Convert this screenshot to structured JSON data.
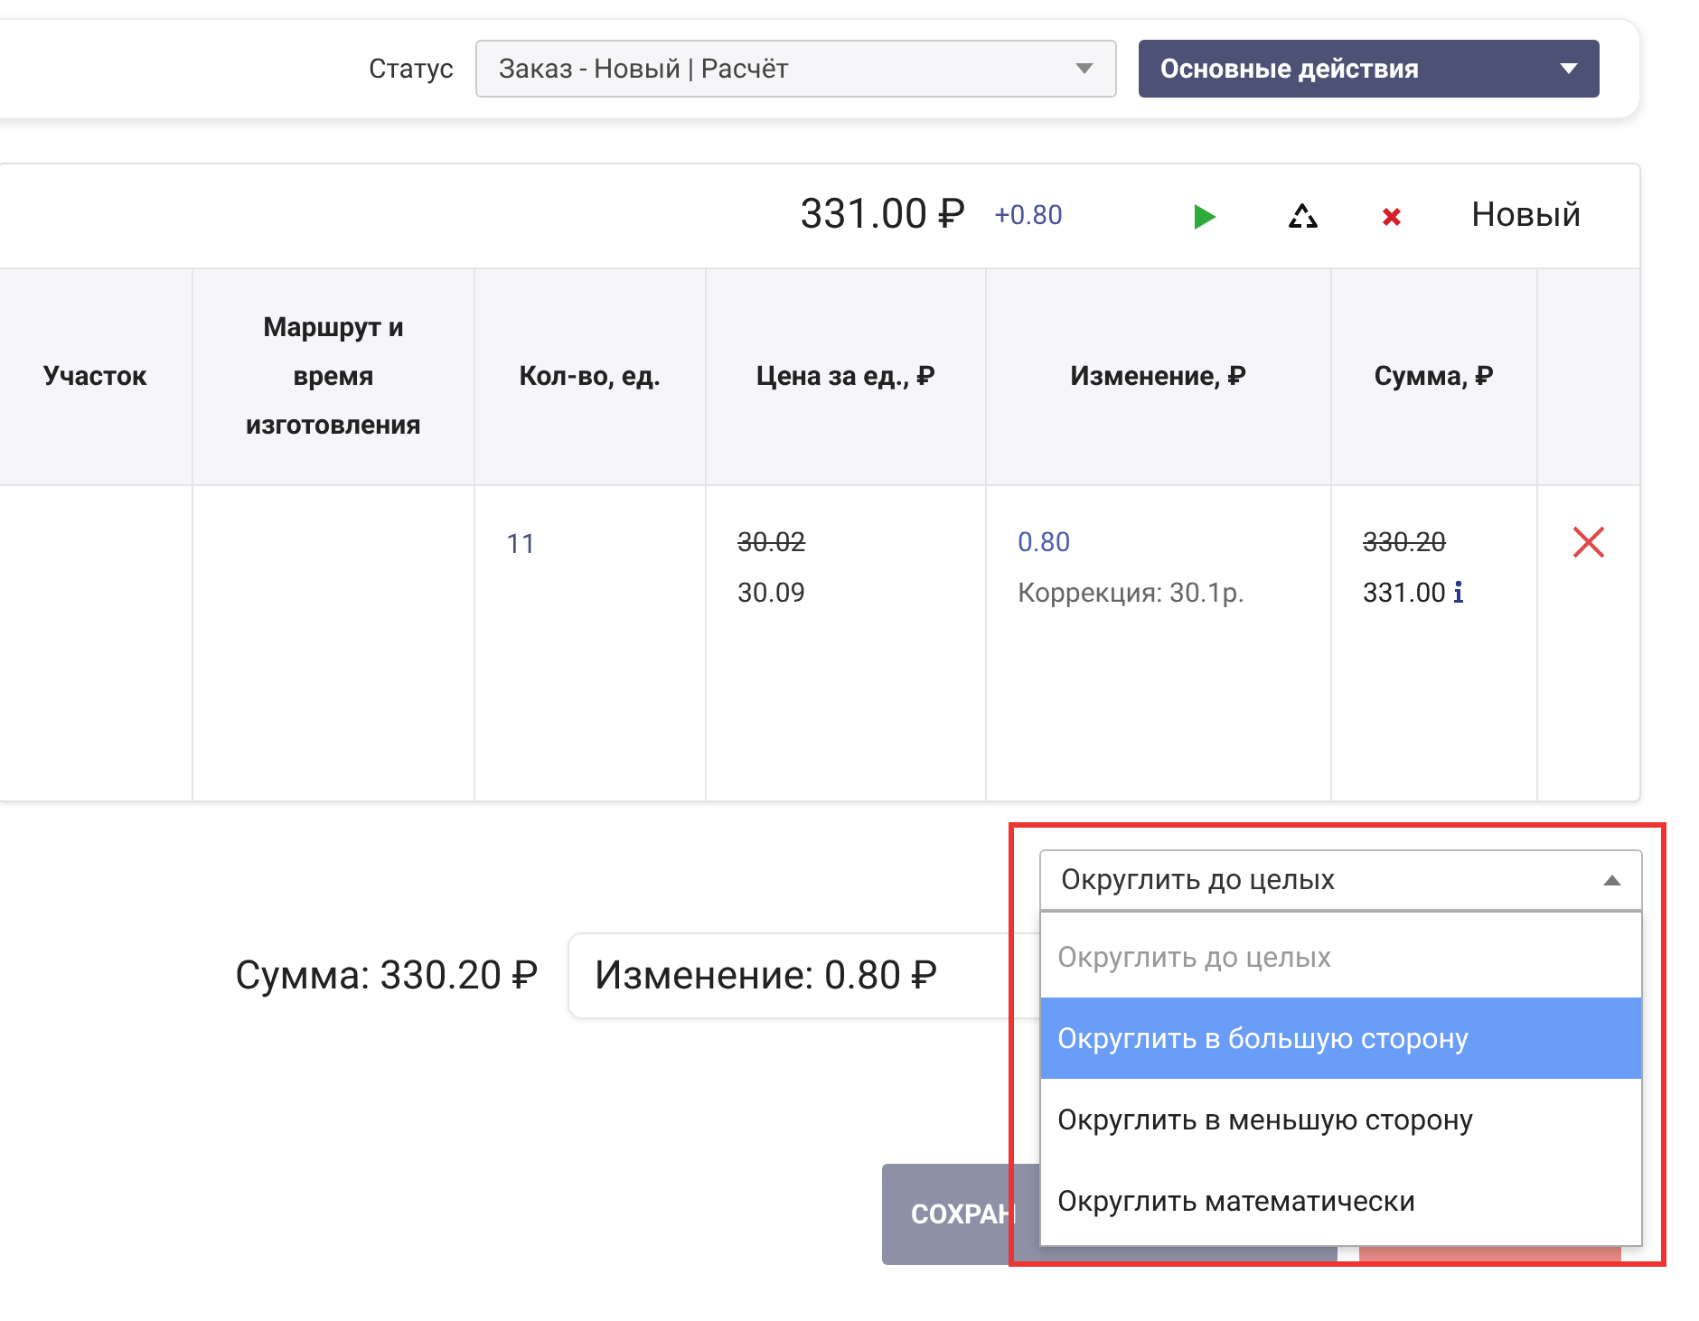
{
  "toolbar": {
    "status_label": "Статус",
    "status_value": "Заказ - Новый | Расчёт",
    "actions_button": "Основные действия"
  },
  "order": {
    "total": "331.00 ₽",
    "delta": "+0.80",
    "state": "Новый"
  },
  "table": {
    "columns": [
      "Участок",
      "Маршрут и время изготовления",
      "Кол-во, ед.",
      "Цена за ед., ₽",
      "Изменение, ₽",
      "Сумма, ₽"
    ],
    "rows": [
      {
        "area": "",
        "route": "",
        "qty": "11",
        "price_old": "30.02",
        "price_new": "30.09",
        "change": "0.80",
        "correction": "Коррекция: 30.1р.",
        "sum_old": "330.20",
        "sum_new": "331.00"
      }
    ]
  },
  "summary": {
    "sum": "Сумма: 330.20 ₽",
    "change": "Изменение: 0.80 ₽"
  },
  "rounding": {
    "value": "Округлить до целых",
    "expanded": true,
    "options": [
      {
        "label": "Округлить до целых",
        "highlighted": false,
        "disabled": true
      },
      {
        "label": "Округлить в большую сторону",
        "highlighted": true,
        "disabled": false
      },
      {
        "label": "Округлить в меньшую сторону",
        "highlighted": false,
        "disabled": false
      },
      {
        "label": "Округлить математически",
        "highlighted": false,
        "disabled": false
      }
    ]
  },
  "save_button": "СОХРАН"
}
